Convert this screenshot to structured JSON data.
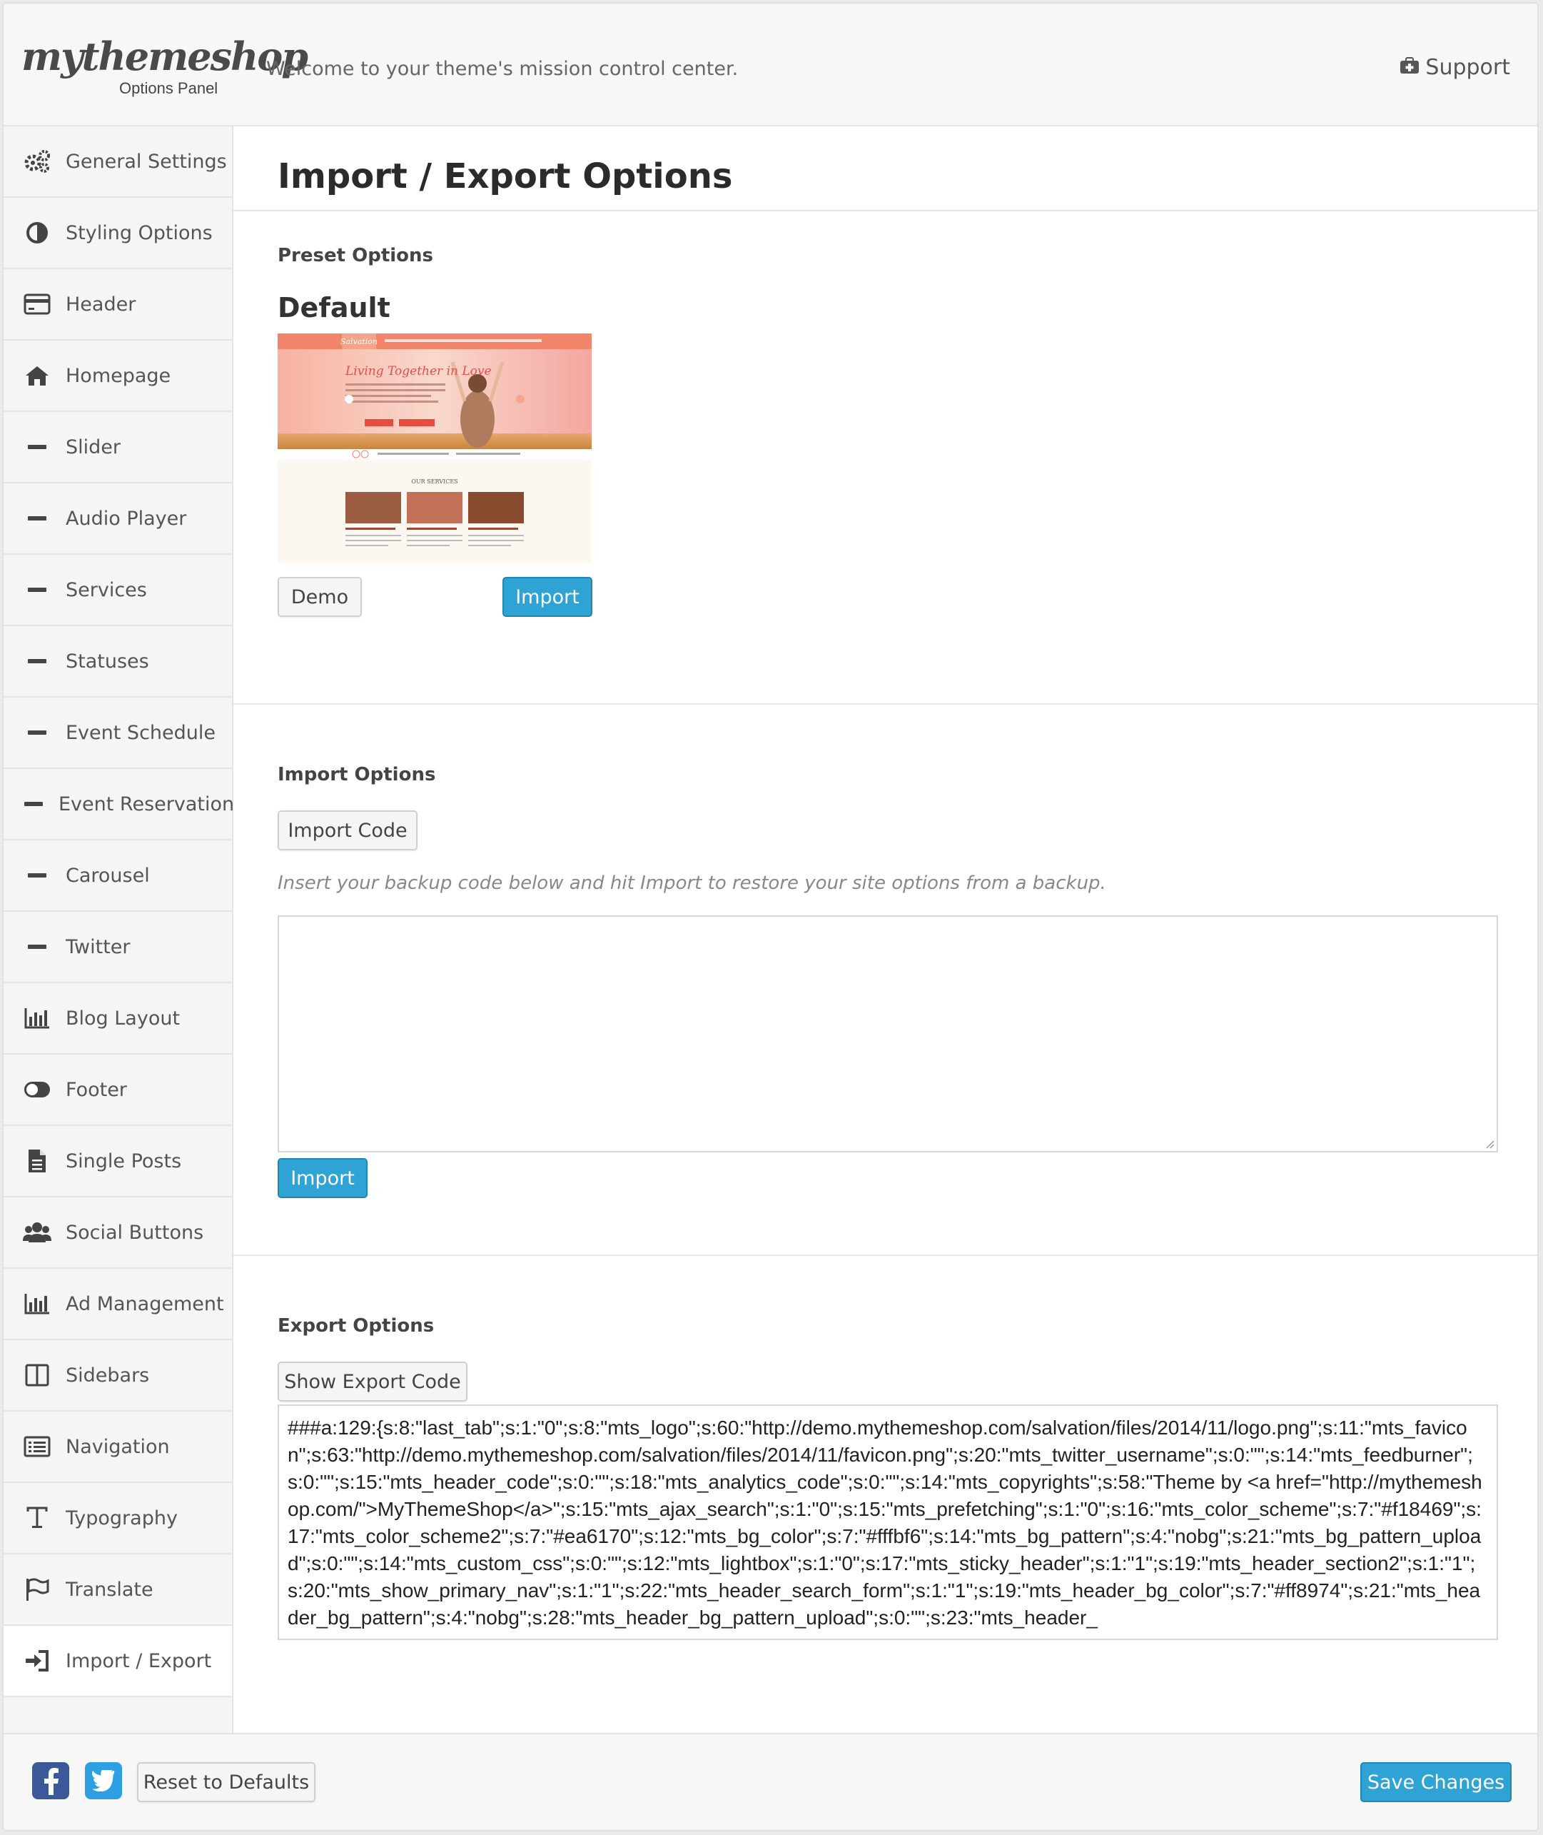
{
  "header": {
    "logo_text": "mythemeshop",
    "logo_subtitle": "Options Panel",
    "welcome": "Welcome to your theme's mission control center.",
    "support_label": "Support"
  },
  "sidebar": {
    "items": [
      {
        "label": "General Settings",
        "icon": "gears-icon"
      },
      {
        "label": "Styling Options",
        "icon": "contrast-icon"
      },
      {
        "label": "Header",
        "icon": "credit-card-icon"
      },
      {
        "label": "Homepage",
        "icon": "home-icon"
      },
      {
        "label": "Slider",
        "icon": "dash-icon"
      },
      {
        "label": "Audio Player",
        "icon": "dash-icon"
      },
      {
        "label": "Services",
        "icon": "dash-icon"
      },
      {
        "label": "Statuses",
        "icon": "dash-icon"
      },
      {
        "label": "Event Schedule",
        "icon": "dash-icon"
      },
      {
        "label": "Event Reservation",
        "icon": "dash-icon"
      },
      {
        "label": "Carousel",
        "icon": "dash-icon"
      },
      {
        "label": "Twitter",
        "icon": "dash-icon"
      },
      {
        "label": "Blog Layout",
        "icon": "bar-chart-icon"
      },
      {
        "label": "Footer",
        "icon": "toggle-icon"
      },
      {
        "label": "Single Posts",
        "icon": "file-icon"
      },
      {
        "label": "Social Buttons",
        "icon": "users-icon"
      },
      {
        "label": "Ad Management",
        "icon": "bar-chart-icon"
      },
      {
        "label": "Sidebars",
        "icon": "columns-icon"
      },
      {
        "label": "Navigation",
        "icon": "list-icon"
      },
      {
        "label": "Typography",
        "icon": "text-icon"
      },
      {
        "label": "Translate",
        "icon": "flag-icon"
      },
      {
        "label": "Import / Export",
        "icon": "sign-in-icon"
      }
    ]
  },
  "main": {
    "title": "Import / Export Options",
    "preset": {
      "section_title": "Preset Options",
      "name": "Default",
      "demo_label": "Demo",
      "import_label": "Import",
      "thumbnail": {
        "logo": "Salvation",
        "headline": "Living Together in Love",
        "services_heading": "OUR SERVICES"
      }
    },
    "import": {
      "section_title": "Import Options",
      "code_button": "Import Code",
      "hint": "Insert your backup code below and hit Import to restore your site options from a backup.",
      "textarea_value": "",
      "submit_label": "Import"
    },
    "export": {
      "section_title": "Export Options",
      "show_button": "Show Export Code",
      "code": "###a:129:{s:8:\"last_tab\";s:1:\"0\";s:8:\"mts_logo\";s:60:\"http://demo.mythemeshop.com/salvation/files/2014/11/logo.png\";s:11:\"mts_favicon\";s:63:\"http://demo.mythemeshop.com/salvation/files/2014/11/favicon.png\";s:20:\"mts_twitter_username\";s:0:\"\";s:14:\"mts_feedburner\";s:0:\"\";s:15:\"mts_header_code\";s:0:\"\";s:18:\"mts_analytics_code\";s:0:\"\";s:14:\"mts_copyrights\";s:58:\"Theme by <a href=\"http://mythemeshop.com/\">MyThemeShop</a>\";s:15:\"mts_ajax_search\";s:1:\"0\";s:15:\"mts_prefetching\";s:1:\"0\";s:16:\"mts_color_scheme\";s:7:\"#f18469\";s:17:\"mts_color_scheme2\";s:7:\"#ea6170\";s:12:\"mts_bg_color\";s:7:\"#fffbf6\";s:14:\"mts_bg_pattern\";s:4:\"nobg\";s:21:\"mts_bg_pattern_upload\";s:0:\"\";s:14:\"mts_custom_css\";s:0:\"\";s:12:\"mts_lightbox\";s:1:\"0\";s:17:\"mts_sticky_header\";s:1:\"1\";s:19:\"mts_header_section2\";s:1:\"1\";s:20:\"mts_show_primary_nav\";s:1:\"1\";s:22:\"mts_header_search_form\";s:1:\"1\";s:19:\"mts_header_bg_color\";s:7:\"#ff8974\";s:21:\"mts_header_bg_pattern\";s:4:\"nobg\";s:28:\"mts_header_bg_pattern_upload\";s:0:\"\";s:23:\"mts_header_"
    }
  },
  "footer": {
    "reset_label": "Reset to Defaults",
    "save_label": "Save Changes"
  },
  "colors": {
    "primary_button": "#2fa3d3",
    "facebook": "#3b5998",
    "twitter": "#2da0e4",
    "thumbnail_accent": "#f18469"
  }
}
